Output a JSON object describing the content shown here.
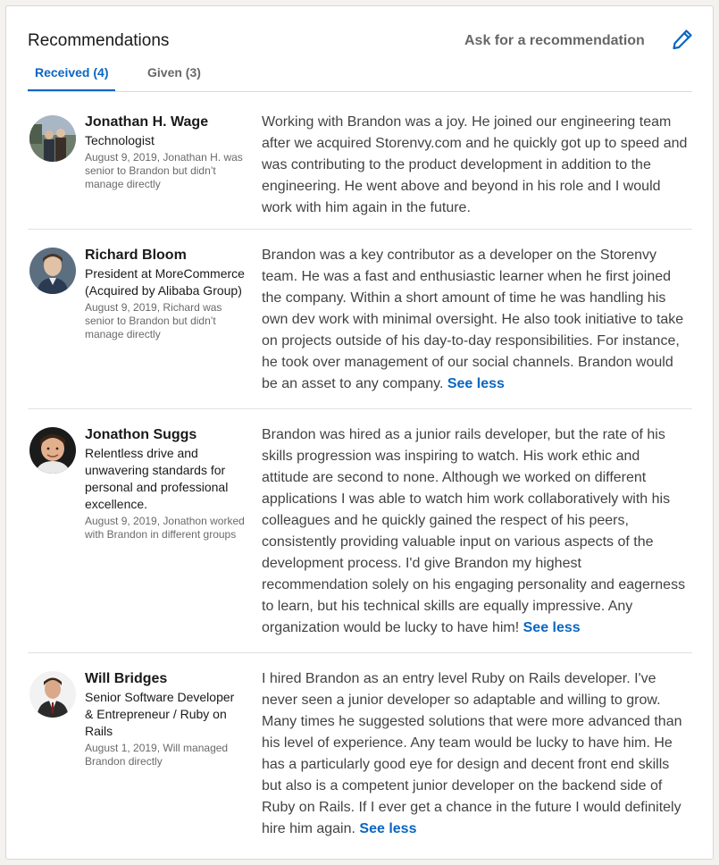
{
  "section": {
    "title": "Recommendations",
    "ask_label": "Ask for a recommendation",
    "edit_icon": "pencil-icon"
  },
  "tabs": [
    {
      "label": "Received (4)",
      "active": true
    },
    {
      "label": "Given (3)",
      "active": false
    }
  ],
  "colors": {
    "accent": "#0a66c2",
    "divider": "#e1e1e1",
    "card_border": "#d6d6d6",
    "background": "#f3f2ef"
  },
  "recommendations": [
    {
      "name": "Jonathan H. Wage",
      "headline": "Technologist",
      "meta": "August 9, 2019, Jonathan H. was senior to Brandon but didn’t manage directly",
      "text": "Working with Brandon was a joy. He joined our engineering team after we acquired Storenvy.com and he quickly got up to speed and was contributing to the product development in addition to the engineering. He went above and beyond in his role and I would work with him again in the future.",
      "see_less": ""
    },
    {
      "name": "Richard Bloom",
      "headline": "President at MoreCommerce (Acquired by Alibaba Group)",
      "meta": "August 9, 2019, Richard was senior to Brandon but didn’t manage directly",
      "text": "Brandon was a key contributor as a developer on the Storenvy team. He was a fast and enthusiastic learner when he first joined the company. Within a short amount of time he was handling his own dev work with minimal oversight. He also took initiative to take on projects outside of his day-to-day responsibilities. For instance, he took over management of our social channels. Brandon would be an asset to any company.",
      "see_less": "See less"
    },
    {
      "name": "Jonathon Suggs",
      "headline": "Relentless drive and unwavering standards for personal and professional excellence.",
      "meta": "August 9, 2019, Jonathon worked with Brandon in different groups",
      "text": "Brandon was hired as a junior rails developer, but the rate of his skills progression was inspiring to watch. His work ethic and attitude are second to none. Although we worked on different applications I was able to watch him work collaboratively with his colleagues and he quickly gained the respect of his peers, consistently providing valuable input on various aspects of the development process. I'd give Brandon my highest recommendation solely on his engaging personality and eagerness to learn, but his technical skills are equally impressive. Any organization would be lucky to have him!",
      "see_less": "See less"
    },
    {
      "name": "Will Bridges",
      "headline": "Senior Software Developer & Entrepreneur / Ruby on Rails",
      "meta": "August 1, 2019, Will managed Brandon directly",
      "text": "I hired Brandon as an entry level Ruby on Rails developer. I've never seen a junior developer so adaptable and willing to grow. Many times he suggested solutions that were more advanced than his level of experience. Any team would be lucky to have him. He has a particularly good eye for design and decent front end skills but also is a competent junior developer on the backend side of Ruby on Rails. If I ever get a chance in the future I would definitely hire him again.",
      "see_less": "See less"
    }
  ]
}
